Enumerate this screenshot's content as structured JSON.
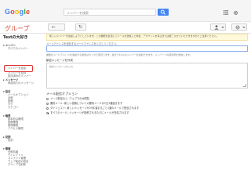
{
  "header": {
    "logo_letters": [
      {
        "ch": "G",
        "color": "#4285f4"
      },
      {
        "ch": "o",
        "color": "#ea4335"
      },
      {
        "ch": "o",
        "color": "#fbbc05"
      },
      {
        "ch": "g",
        "color": "#4285f4"
      },
      {
        "ch": "l",
        "color": "#34a853"
      },
      {
        "ch": "e",
        "color": "#ea4335"
      }
    ],
    "search_placeholder": "メンバーを検索",
    "groups_title": "グループ"
  },
  "sidebar": {
    "group_name": "Testの大好き",
    "items": [
      {
        "label": "▾ メンバー",
        "kind": "sec"
      },
      {
        "label": "すべてのメンバー",
        "kind": "sub"
      },
      {
        "label": "メンバーを追加",
        "kind": "sub"
      },
      {
        "label": "メンバーを招待",
        "kind": "sub"
      },
      {
        "label": "招待済みのメンバー",
        "kind": "sub"
      },
      {
        "label": "確認待ちメンバー",
        "kind": "sub"
      },
      {
        "label": "▸ メッセージ",
        "kind": "sec"
      },
      {
        "label": "承認待ちのメッセージ",
        "kind": "sub"
      },
      {
        "label": "▾ 設定",
        "kind": "sec"
      },
      {
        "label": "メールオプション",
        "kind": "sub"
      },
      {
        "label": "全般",
        "kind": "sub"
      },
      {
        "label": "投稿",
        "kind": "sub"
      },
      {
        "label": "タグ",
        "kind": "sub"
      },
      {
        "label": "カテゴリ",
        "kind": "sub"
      },
      {
        "label": "▾ 権限",
        "kind": "sec"
      },
      {
        "label": "基本的な権限",
        "kind": "sub"
      },
      {
        "label": "投稿権限",
        "kind": "sub"
      },
      {
        "label": "管理権限",
        "kind": "sub"
      },
      {
        "label": "アクセス権限",
        "kind": "sub"
      },
      {
        "label": "▸ 役割",
        "kind": "sec"
      },
      {
        "label": "役割",
        "kind": "sub"
      },
      {
        "label": "▾ 情報",
        "kind": "sec"
      },
      {
        "label": "全般情報",
        "kind": "sub"
      },
      {
        "label": "ディレクトリ",
        "kind": "sub"
      },
      {
        "label": "コンテンツ管理",
        "kind": "sub"
      },
      {
        "label": "ウェブ転送の設定",
        "kind": "sub"
      },
      {
        "label": "グループを削除",
        "kind": "sub"
      }
    ]
  },
  "main": {
    "notice": "新しいメンバーを追加しようとしています。この機能を乱用してメールを送信した場合、アカウントを停止または終了させていただきますのでご注意ください。",
    "hint": "メールアドレスを追加するメールアドレスを入力してください。",
    "note": "複数のメールアドレスを追加する場合はカンマで区切ります。最大で10人のメンバーを追加できます。メンバーへの招待状を送信します。",
    "welcome_label": "歓迎メッセージを作成",
    "welcome_placeholder": "歓迎メッセージを入力",
    "options_title": "メール配信オプション",
    "options": [
      {
        "label": "メール配信なし: ウェブでのみ閲覧",
        "selected": false
      },
      {
        "label": "要約メール: 新しい投稿についての要約メールが1日1通届きます",
        "selected": false
      },
      {
        "label": "ダイジェスト: 新しいメッセージが25件溜まるごと1通のメールで配信されます",
        "selected": false
      },
      {
        "label": "すべてのメール: メッセージが投稿されるたびにメールが送信されます",
        "selected": true
      }
    ]
  }
}
